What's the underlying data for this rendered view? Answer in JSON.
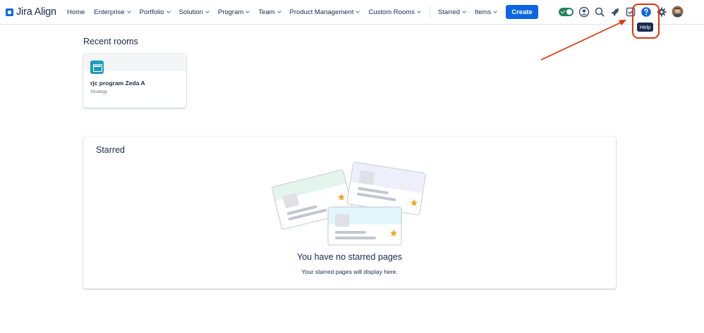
{
  "app": {
    "logo_text": "Jira Align"
  },
  "nav": {
    "items": [
      {
        "label": "Home",
        "dropdown": false
      },
      {
        "label": "Enterprise",
        "dropdown": true
      },
      {
        "label": "Portfolio",
        "dropdown": true
      },
      {
        "label": "Solution",
        "dropdown": true
      },
      {
        "label": "Program",
        "dropdown": true
      },
      {
        "label": "Team",
        "dropdown": true
      },
      {
        "label": "Product Management",
        "dropdown": true
      },
      {
        "label": "Custom Rooms",
        "dropdown": true
      }
    ],
    "right_items": [
      {
        "label": "Starred",
        "dropdown": true
      },
      {
        "label": "Items",
        "dropdown": true
      }
    ],
    "create_label": "Create",
    "help_tooltip": "Help",
    "colors": {
      "accent": "#0c66e4",
      "toggle": "#1f845a",
      "highlight": "#de350b"
    }
  },
  "recent": {
    "title": "Recent rooms",
    "rooms": [
      {
        "name": "rjc program Zeda A",
        "type": "Strategy",
        "icon": "calendar-icon"
      }
    ]
  },
  "starred": {
    "title": "Starred",
    "empty_title": "You have no starred pages",
    "empty_subtitle": "Your starred pages will display here."
  }
}
